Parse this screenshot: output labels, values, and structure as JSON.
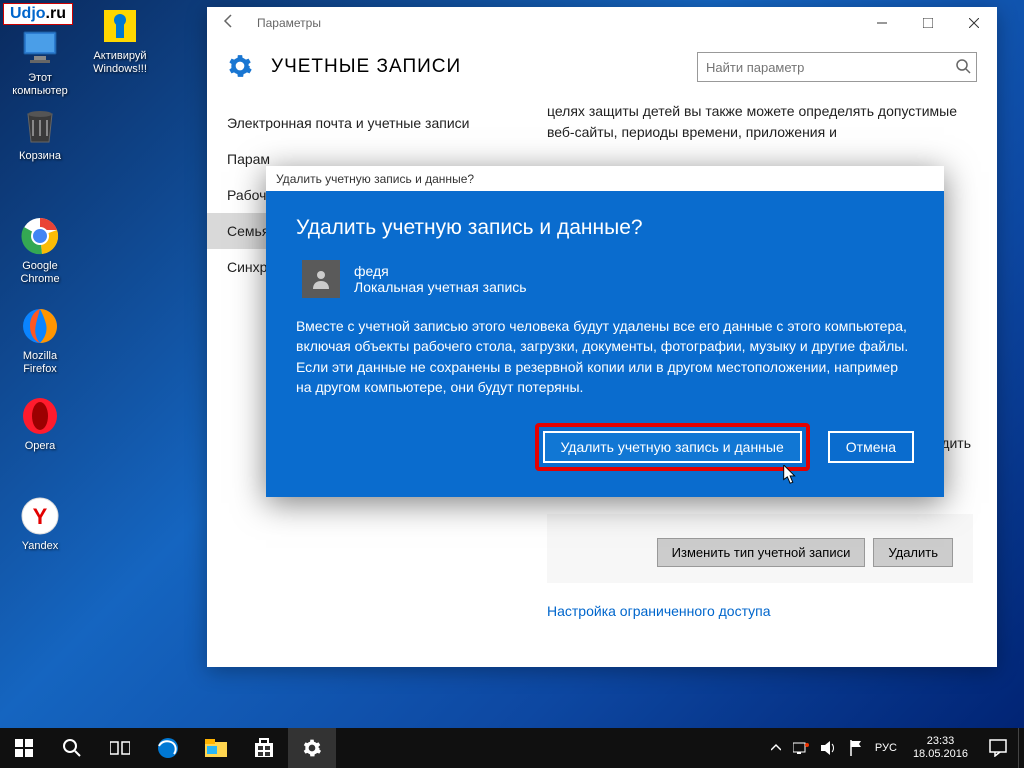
{
  "watermark": {
    "text1": "Udjo",
    "text2": ".ru"
  },
  "desktop_icons": [
    {
      "label": "Этот\nкомпьютер",
      "icon": "pc"
    },
    {
      "label": "Активируй\nWindows!!!",
      "icon": "activate"
    },
    {
      "label": "Корзина",
      "icon": "bin"
    },
    {
      "label": "Google\nChrome",
      "icon": "chrome"
    },
    {
      "label": "Mozilla\nFirefox",
      "icon": "firefox"
    },
    {
      "label": "Opera",
      "icon": "opera"
    },
    {
      "label": "Yandex​",
      "icon": "yandex"
    }
  ],
  "settings": {
    "back_title": "Параметры",
    "heading": "УЧЕТНЫЕ ЗАПИСИ",
    "search_placeholder": "Найти параметр",
    "sidebar": [
      {
        "label": "Электронная почта и учетные записи",
        "sel": false
      },
      {
        "label": "Параметры входа",
        "sel": false,
        "short": "Парам"
      },
      {
        "label": "Рабочий доступ",
        "sel": false,
        "short": "Рабоч"
      },
      {
        "label": "Семья и другие пользователи",
        "sel": true,
        "short": "Семья"
      },
      {
        "label": "Синхронизация параметров",
        "sel": false,
        "short": "Синхро"
      }
    ],
    "content": {
      "top_text": "целях защиты детей вы также можете определять допустимые веб-сайты, периоды времени, приложения и",
      "edit_right": "дить",
      "btn_change": "Изменить тип учетной записи",
      "btn_delete": "Удалить",
      "link": "Настройка ограниченного доступа"
    }
  },
  "dialog": {
    "titlebar": "Удалить учетную запись и данные?",
    "heading": "Удалить учетную запись и данные?",
    "user_name": "федя",
    "user_type": "Локальная учетная запись",
    "message": "Вместе с учетной записью этого человека будут удалены все его данные с этого компьютера, включая объекты рабочего стола, загрузки, документы, фотографии, музыку и другие файлы. Если эти данные не сохранены в резервной копии или в другом местоположении, например на другом компьютере, они будут потеряны.",
    "btn_confirm": "Удалить учетную запись и данные",
    "btn_cancel": "Отмена"
  },
  "taskbar": {
    "lang": "РУС",
    "time": "23:33",
    "date": "18.05.2016"
  }
}
